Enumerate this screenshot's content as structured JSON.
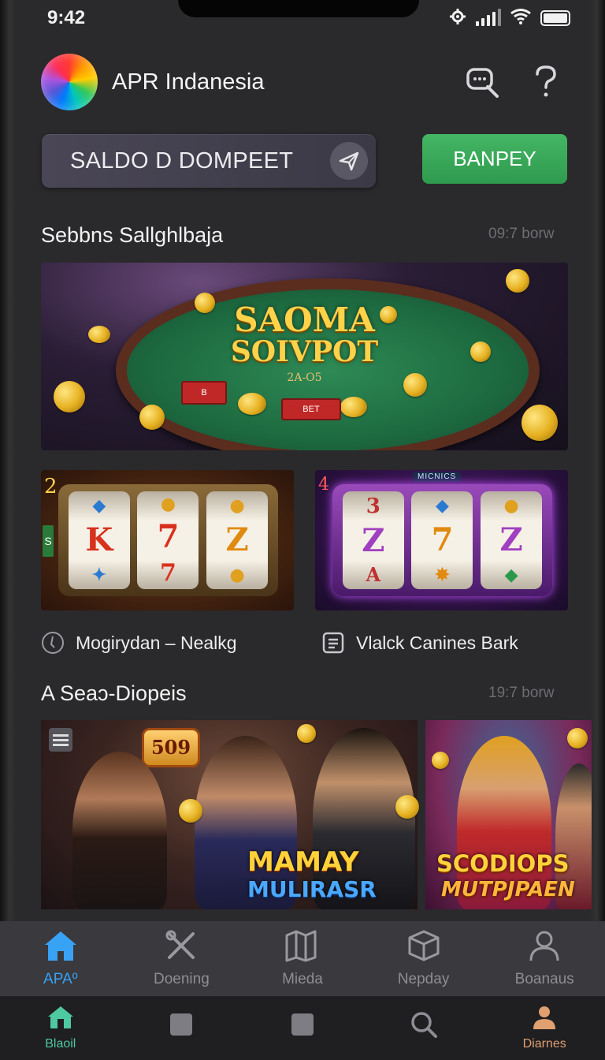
{
  "status": {
    "time": "9:42"
  },
  "header": {
    "app_name": "APR Indanesia",
    "icons": [
      "chat-search-icon",
      "help-icon"
    ]
  },
  "wallet": {
    "label": "SALDO D DOMPEET",
    "icon": "send-icon",
    "action_label": "BANPEY"
  },
  "section1": {
    "title": "Sebbns Sallghlbaja",
    "meta": "09:7 borw",
    "banner": {
      "title_line1": "SAOMA",
      "title_line2": "SOIVPOT",
      "subtitle": "2A-O5",
      "chip_a": "B",
      "chip_b": "BET"
    }
  },
  "games": [
    {
      "label": "Mogirydan – Nealkg",
      "icon": "clock-icon",
      "symbols": [
        "K",
        "7",
        "Z"
      ],
      "side_left": "2",
      "side_marker": "S"
    },
    {
      "label": "Vlalck Canines Bark",
      "icon": "document-icon",
      "symbols": [
        "Z",
        "7",
        "Z"
      ],
      "badge": "MICNICS",
      "side_left": "4"
    }
  ],
  "section2": {
    "title": "A Seaɔ-Diopeis",
    "meta": "19:7 borw",
    "promos": [
      {
        "title": "MAMAY",
        "subtitle": "MULIRASR",
        "badge": "509"
      },
      {
        "title": "SCODIOPS",
        "subtitle": "MUTPJPAEN"
      }
    ]
  },
  "nav_primary": [
    {
      "label": "APAº",
      "icon": "home-icon",
      "active": true
    },
    {
      "label": "Doening",
      "icon": "tools-icon",
      "active": false
    },
    {
      "label": "Mieda",
      "icon": "map-icon",
      "active": false
    },
    {
      "label": "Nepday",
      "icon": "box-icon",
      "active": false
    },
    {
      "label": "Boanaus",
      "icon": "user-icon",
      "active": false
    }
  ],
  "nav_secondary": [
    {
      "label": "Blaoil",
      "icon": "home-icon"
    },
    {
      "label": "",
      "icon": "square-icon"
    },
    {
      "label": "",
      "icon": "square-icon"
    },
    {
      "label": "",
      "icon": "search-icon"
    },
    {
      "label": "Diarnes",
      "icon": "person-icon"
    }
  ],
  "colors": {
    "accent_green": "#3aa85a",
    "accent_blue": "#38a2f5",
    "secondary_green": "#4ec9a0",
    "secondary_orange": "#e0a070"
  }
}
